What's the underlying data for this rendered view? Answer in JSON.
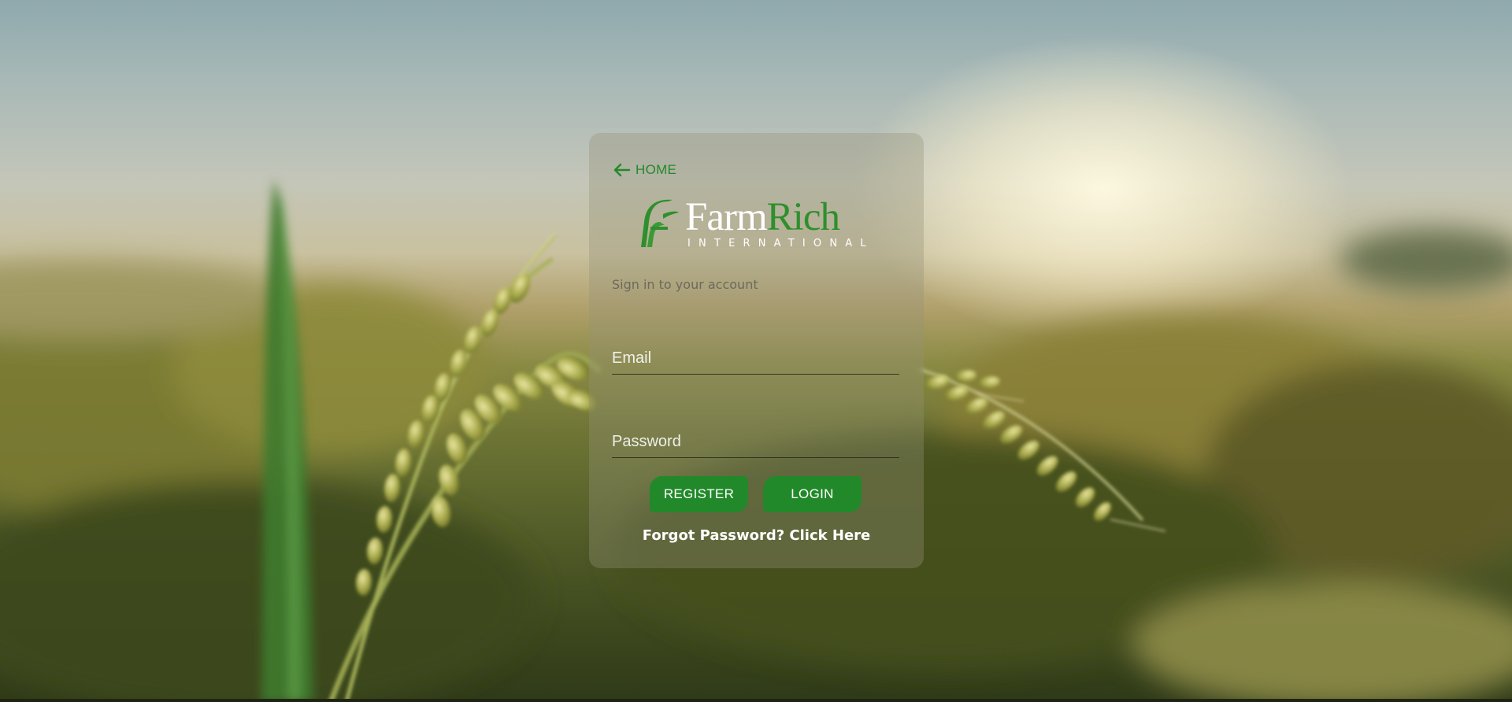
{
  "page": {
    "background": "blurred-rice-field-sunset",
    "accent_color": "#22892a"
  },
  "nav": {
    "home_icon": "arrow-left-icon",
    "home_label": "HOME"
  },
  "logo": {
    "icon": "farmrich-ff-logo-icon",
    "word_primary": "Farm",
    "word_secondary": "Rich",
    "sub": "INTERNATIONAL"
  },
  "form": {
    "subtitle": "Sign in to your account",
    "email_placeholder": "Email",
    "email_value": "",
    "password_placeholder": "Password",
    "password_value": "",
    "register_label": "REGISTER",
    "login_label": "LOGIN",
    "forgot_label": "Forgot Password? Click Here"
  }
}
